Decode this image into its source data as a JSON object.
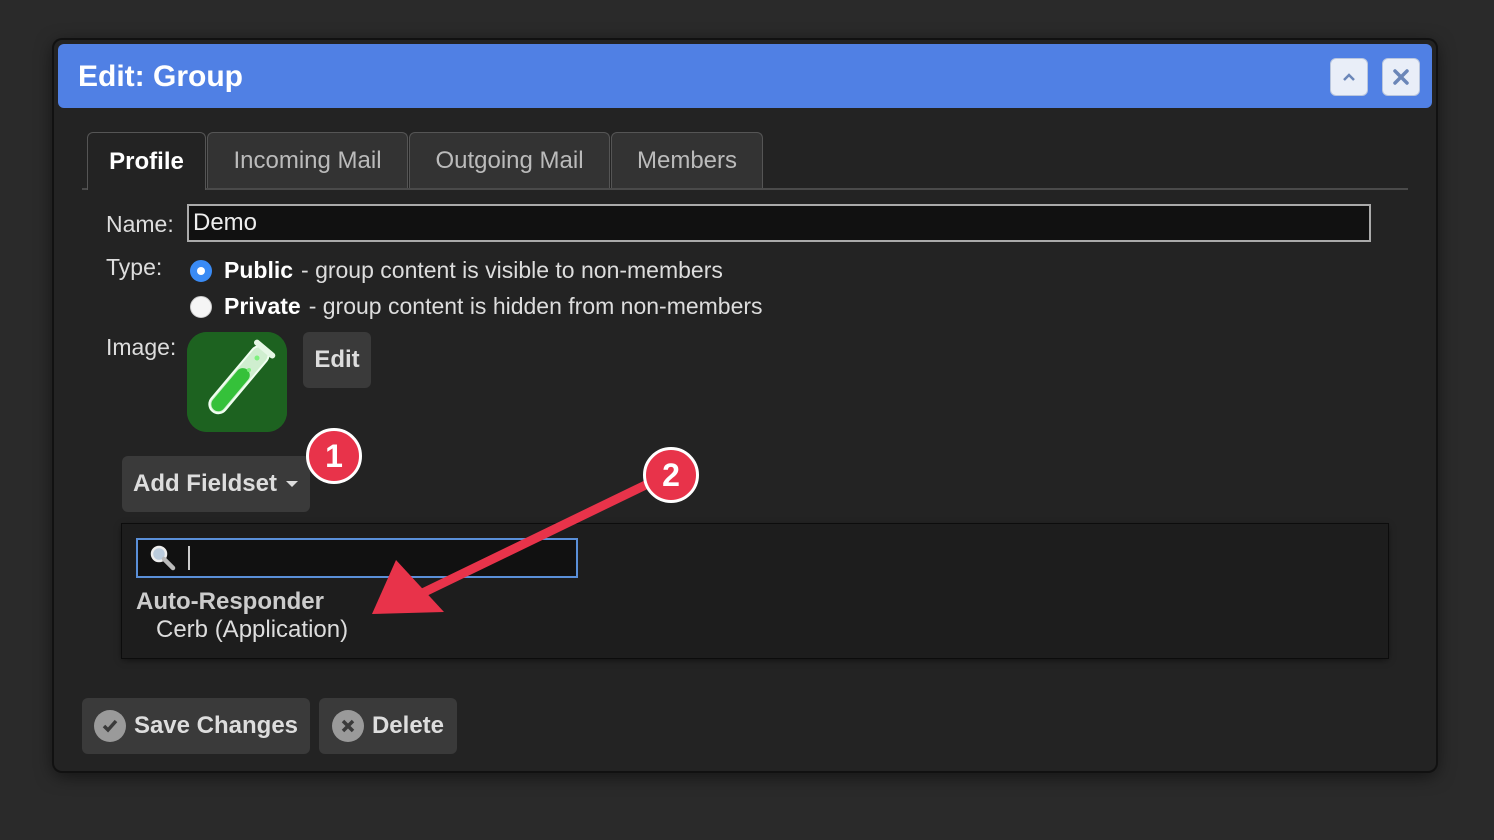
{
  "dialog": {
    "title": "Edit: Group",
    "collapse_icon": "chevron-up-icon",
    "close_icon": "close-icon",
    "titlebar_color": "#5080e4"
  },
  "tabs": [
    {
      "label": "Profile",
      "active": true
    },
    {
      "label": "Incoming Mail",
      "active": false
    },
    {
      "label": "Outgoing Mail",
      "active": false
    },
    {
      "label": "Members",
      "active": false
    }
  ],
  "form": {
    "name_label": "Name:",
    "name_value": "Demo",
    "type_label": "Type:",
    "type_options": [
      {
        "title": "Public",
        "desc": "- group content is visible to non-members",
        "selected": true
      },
      {
        "title": "Private",
        "desc": "- group content is hidden from non-members",
        "selected": false
      }
    ],
    "image_label": "Image:",
    "image_icon": "test-tube-icon",
    "image_edit_label": "Edit"
  },
  "fieldset": {
    "add_label": "Add Fieldset",
    "search_placeholder": "",
    "search_icon": "magnifier-icon",
    "menu_group": "Auto-Responder",
    "menu_item": "Cerb (Application)"
  },
  "annotations": {
    "badge_1": "1",
    "badge_2": "2",
    "color": "#e8334a"
  },
  "footer": {
    "save_label": "Save Changes",
    "delete_label": "Delete"
  }
}
